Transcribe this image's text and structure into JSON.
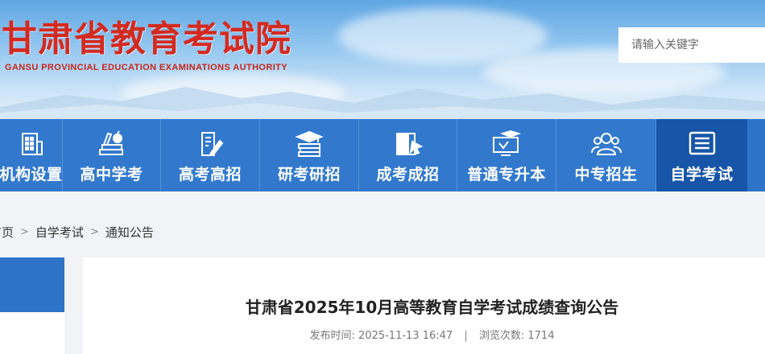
{
  "header": {
    "title": "甘肃省教育考试院",
    "subtitle": "GANSU PROVINCIAL EDUCATION EXAMINATIONS AUTHORITY",
    "search_placeholder": "请输入关键字"
  },
  "nav": {
    "items": [
      {
        "label": "机构设置",
        "icon": "building-icon"
      },
      {
        "label": "高中学考",
        "icon": "books-apple-icon"
      },
      {
        "label": "高考高招",
        "icon": "document-pen-icon"
      },
      {
        "label": "研考研招",
        "icon": "graduation-cap-books-icon"
      },
      {
        "label": "成考成招",
        "icon": "book-cursor-icon"
      },
      {
        "label": "普通专升本",
        "icon": "monitor-cap-icon"
      },
      {
        "label": "中专招生",
        "icon": "users-icon"
      },
      {
        "label": "自学考试",
        "icon": "list-document-icon",
        "active": true
      }
    ]
  },
  "breadcrumb": {
    "items": [
      "首页",
      "自学考试",
      "通知公告"
    ],
    "separator": ">"
  },
  "article": {
    "title": "甘肃省2025年10月高等教育自学考试成绩查询公告",
    "publish_label": "发布时间:",
    "publish_time": "2025-11-13 16:47",
    "divider": "|",
    "views_label": "浏览次数:",
    "views": "1714"
  },
  "colors": {
    "nav_bg": "#3279cd",
    "nav_active": "#1655a7",
    "logo_red": "#d42a20"
  }
}
